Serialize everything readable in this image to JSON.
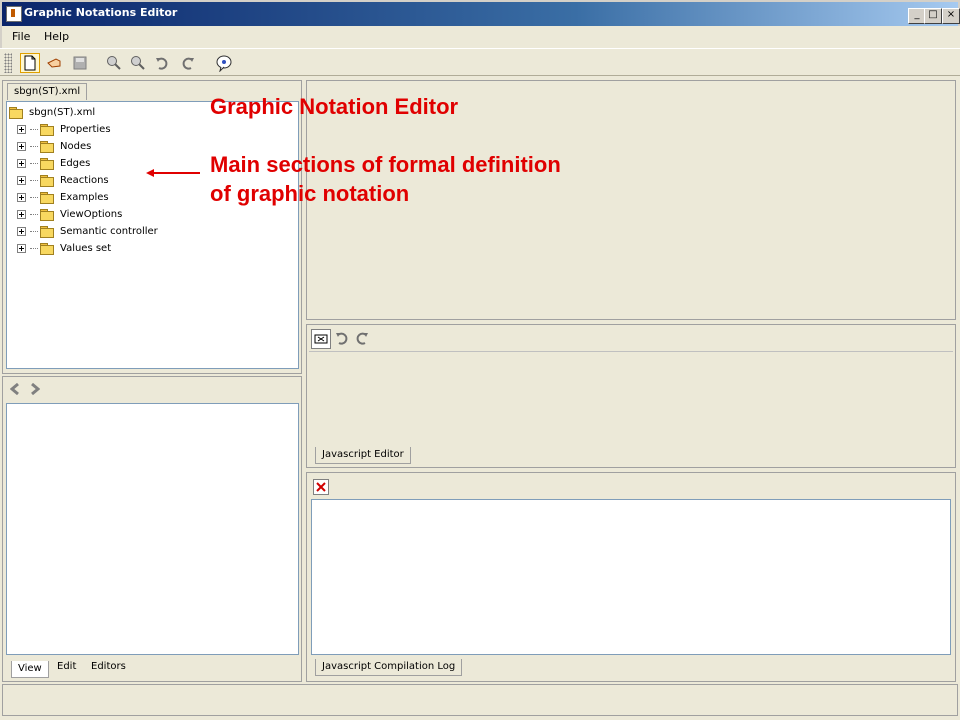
{
  "window": {
    "title": "Graphic Notations Editor",
    "min": "_",
    "max": "□",
    "close": "×"
  },
  "menu": {
    "items": [
      {
        "label": "File"
      },
      {
        "label": "Help"
      }
    ]
  },
  "toolbar": {
    "icons": [
      "new-file-icon",
      "open-icon",
      "save-icon",
      "zoom-in-icon",
      "zoom-out-icon",
      "undo-icon",
      "redo-icon",
      "info-icon"
    ]
  },
  "tree": {
    "tab_label": "sbgn(ST).xml",
    "root": "sbgn(ST).xml",
    "items": [
      {
        "label": "Properties"
      },
      {
        "label": "Nodes"
      },
      {
        "label": "Edges"
      },
      {
        "label": "Reactions"
      },
      {
        "label": "Examples"
      },
      {
        "label": "ViewOptions"
      },
      {
        "label": "Semantic controller"
      },
      {
        "label": "Values set"
      }
    ]
  },
  "left_bottom_tabs": [
    {
      "label": "View"
    },
    {
      "label": "Edit"
    },
    {
      "label": "Editors"
    }
  ],
  "js_editor": {
    "tab_label": "Javascript Editor"
  },
  "js_log": {
    "tab_label": "Javascript Compilation Log"
  },
  "annotations": {
    "title": "Graphic Notation Editor",
    "line1": "Main sections of formal definition",
    "line2": "of graphic notation"
  }
}
